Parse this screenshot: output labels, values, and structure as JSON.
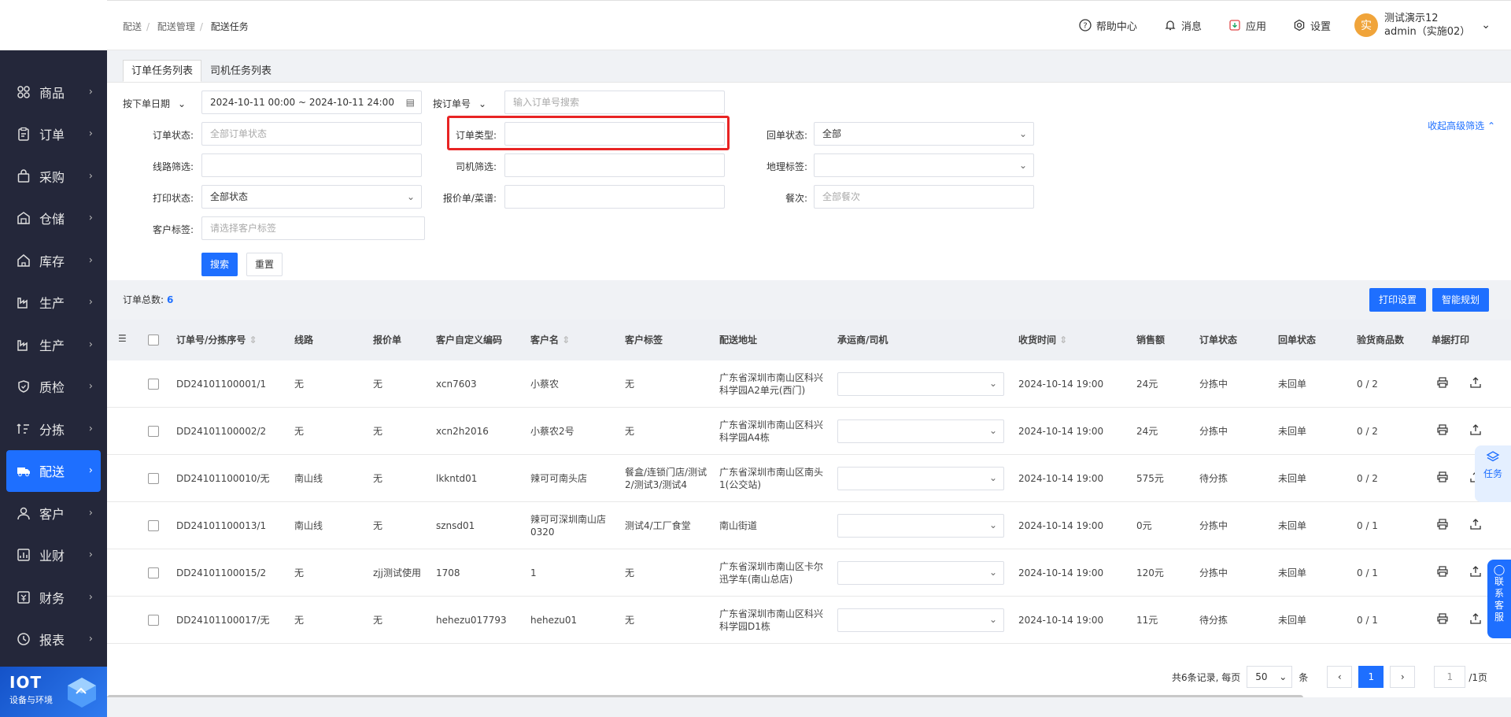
{
  "breadcrumb": [
    "配送",
    "配送管理",
    "配送任务"
  ],
  "topbar": {
    "help": "帮助中心",
    "messages": "消息",
    "apps": "应用",
    "settings": "设置",
    "avatar_char": "实",
    "user_name": "测试演示12",
    "user_role": "admin（实施02）"
  },
  "sidebar": {
    "items": [
      {
        "label": "商品",
        "icon": "grid-icon"
      },
      {
        "label": "订单",
        "icon": "clipboard-icon"
      },
      {
        "label": "采购",
        "icon": "bag-icon"
      },
      {
        "label": "仓储",
        "icon": "warehouse-icon"
      },
      {
        "label": "库存",
        "icon": "home-icon"
      },
      {
        "label": "生产",
        "icon": "factory-icon"
      },
      {
        "label": "生产",
        "icon": "factory-icon"
      },
      {
        "label": "质检",
        "icon": "shield-icon"
      },
      {
        "label": "分拣",
        "icon": "sort-icon"
      },
      {
        "label": "配送",
        "icon": "truck-icon"
      },
      {
        "label": "客户",
        "icon": "user-icon"
      },
      {
        "label": "业财",
        "icon": "chart-icon"
      },
      {
        "label": "财务",
        "icon": "finance-icon"
      },
      {
        "label": "报表",
        "icon": "clock-icon"
      }
    ],
    "active_index": 9,
    "iot_title": "IOT",
    "iot_subtitle": "设备与环境"
  },
  "tabs": [
    "订单任务列表",
    "司机任务列表"
  ],
  "filters": {
    "date_type": "按下单日期",
    "date_range": "2024-10-11 00:00 ~ 2024-10-11 24:00",
    "search_type": "按订单号",
    "search_placeholder": "输入订单号搜索",
    "collapse": "收起高级筛选",
    "order_status_label": "订单状态:",
    "order_status_placeholder": "全部订单状态",
    "order_type_label": "订单类型:",
    "return_status_label": "回单状态:",
    "return_status_value": "全部",
    "route_label": "线路筛选:",
    "driver_label": "司机筛选:",
    "geo_label": "地理标签:",
    "print_label": "打印状态:",
    "print_value": "全部状态",
    "quote_label": "报价单/菜谱:",
    "meal_label": "餐次:",
    "meal_placeholder": "全部餐次",
    "customer_tag_label": "客户标签:",
    "customer_tag_placeholder": "请选择客户标签",
    "search_btn": "搜索",
    "reset_btn": "重置"
  },
  "summary": {
    "label": "订单总数:",
    "count": "6"
  },
  "actions": {
    "print_settings": "打印设置",
    "smart_plan": "智能规划"
  },
  "table": {
    "headers": [
      "订单号/分拣序号",
      "线路",
      "报价单",
      "客户自定义编码",
      "客户名",
      "客户标签",
      "配送地址",
      "承运商/司机",
      "收货时间",
      "销售额",
      "订单状态",
      "回单状态",
      "验货商品数",
      "单据打印"
    ],
    "rows": [
      {
        "order": "DD24101100001/1",
        "route": "无",
        "quote": "无",
        "code": "xcn7603",
        "name": "小蔡农",
        "tag": "无",
        "addr": "广东省深圳市南山区科兴科学园A2单元(西门)",
        "time": "2024-10-14 19:00",
        "sales": "24元",
        "status": "分拣中",
        "ret": "未回单",
        "check": "0 / 2"
      },
      {
        "order": "DD24101100002/2",
        "route": "无",
        "quote": "无",
        "code": "xcn2h2016",
        "name": "小蔡农2号",
        "tag": "无",
        "addr": "广东省深圳市南山区科兴科学园A4栋",
        "time": "2024-10-14 19:00",
        "sales": "24元",
        "status": "分拣中",
        "ret": "未回单",
        "check": "0 / 2"
      },
      {
        "order": "DD24101100010/无",
        "route": "南山线",
        "quote": "无",
        "code": "lkkntd01",
        "name": "辣可可南头店",
        "tag": "餐盒/连锁门店/测试2/测试3/测试4",
        "addr": "广东省深圳市南山区南头1(公交站)",
        "time": "2024-10-14 19:00",
        "sales": "575元",
        "status": "待分拣",
        "ret": "未回单",
        "check": "0 / 2"
      },
      {
        "order": "DD24101100013/1",
        "route": "南山线",
        "quote": "无",
        "code": "sznsd01",
        "name": "辣可可深圳南山店0320",
        "tag": "测试4/工厂食堂",
        "addr": "南山街道",
        "time": "2024-10-14 19:00",
        "sales": "0元",
        "status": "分拣中",
        "ret": "未回单",
        "check": "0 / 1"
      },
      {
        "order": "DD24101100015/2",
        "route": "无",
        "quote": "zjj测试使用",
        "code": "1708",
        "name": "1",
        "tag": "无",
        "addr": "广东省深圳市南山区卡尔迅学车(南山总店)",
        "time": "2024-10-14 19:00",
        "sales": "120元",
        "status": "分拣中",
        "ret": "未回单",
        "check": "0 / 1"
      },
      {
        "order": "DD24101100017/无",
        "route": "无",
        "quote": "无",
        "code": "hehezu017793",
        "name": "hehezu01",
        "tag": "无",
        "addr": "广东省深圳市南山区科兴科学园D1栋",
        "time": "2024-10-14 19:00",
        "sales": "11元",
        "status": "待分拣",
        "ret": "未回单",
        "check": "0 / 1"
      }
    ]
  },
  "pagination": {
    "total_text": "共6条记录, 每页",
    "page_size": "50",
    "unit": "条",
    "current": "1",
    "jump_value": "1",
    "total_pages": "/1页"
  },
  "float": {
    "task": "任务",
    "service": "联系客服"
  },
  "colors": {
    "primary": "#1e6fff",
    "sidebar": "#24273a",
    "highlight": "#e82424"
  }
}
